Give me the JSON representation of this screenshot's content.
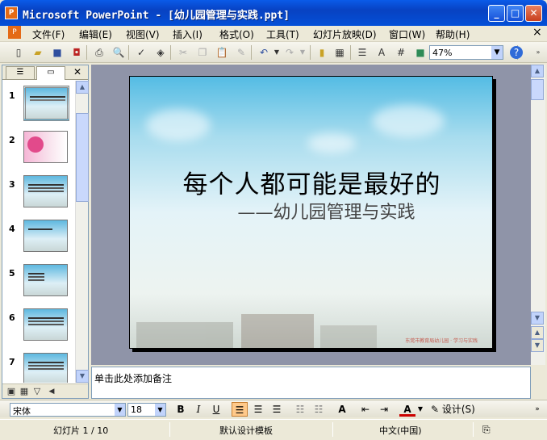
{
  "window": {
    "title": "Microsoft PowerPoint - [幼儿园管理与实践.ppt]",
    "app_icon": "P",
    "minimize": "_",
    "maximize": "□",
    "close": "✕"
  },
  "menu": {
    "items": [
      "文件(F)",
      "编辑(E)",
      "视图(V)",
      "插入(I)",
      "格式(O)",
      "工具(T)",
      "幻灯片放映(D)",
      "窗口(W)",
      "帮助(H)"
    ],
    "close": "×"
  },
  "toolbar": {
    "zoom": "47%",
    "help": "?"
  },
  "left_pane": {
    "close": "✕",
    "slide_numbers": [
      "1",
      "2",
      "3",
      "4",
      "5",
      "6",
      "7"
    ]
  },
  "slide": {
    "title": "每个人都可能是最好的",
    "subtitle": "——幼儿园管理与实践",
    "caption": "东莞市教育局幼儿园 · 学习与实践"
  },
  "notes": {
    "placeholder": "单击此处添加备注"
  },
  "format_bar": {
    "font": "宋体",
    "size": "18",
    "bold": "B",
    "italic": "I",
    "underline": "U",
    "font_color": "A",
    "design": "设计(S)"
  },
  "status": {
    "slide": "幻灯片 1 / 10",
    "template": "默认设计模板",
    "language": "中文(中国)"
  },
  "colors": {
    "titlebar": "#0A5BE8",
    "accent": "#FFC98A"
  }
}
